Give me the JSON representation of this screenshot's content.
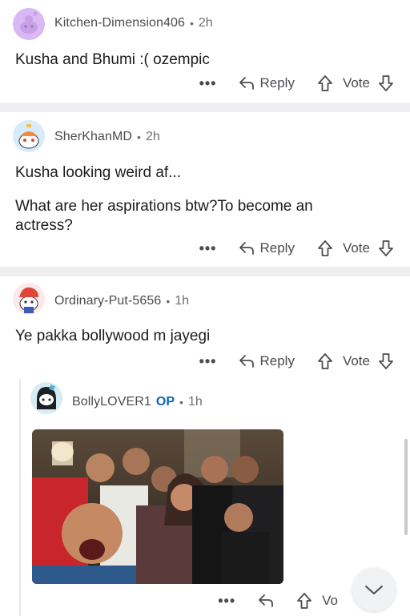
{
  "comments": [
    {
      "username": "Kitchen-Dimension406",
      "time": "2h",
      "body_lines": [
        "Kusha and Bhumi :( ozempic"
      ],
      "reply_label": "Reply",
      "vote_label": "Vote",
      "avatar_icon": "snoo-avatar-purple"
    },
    {
      "username": "SherKhanMD",
      "time": "2h",
      "body_lines": [
        "Kusha looking weird af...",
        "What are her aspirations btw?To become an",
        "actress?"
      ],
      "reply_label": "Reply",
      "vote_label": "Vote",
      "avatar_icon": "snoo-avatar-propeller-hat"
    },
    {
      "username": "Ordinary-Put-5656",
      "time": "1h",
      "body_lines": [
        "Ye pakka bollywood m jayegi"
      ],
      "reply_label": "Reply",
      "vote_label": "Vote",
      "avatar_icon": "snoo-avatar-red-hair"
    },
    {
      "username": "BollyLOVER1",
      "op_badge": "OP",
      "time": "1h",
      "vote_label_partial": "Vo",
      "avatar_icon": "snoo-avatar-black-hood",
      "image_alt": "group-selfie-photo"
    }
  ],
  "separator": "•",
  "more_label": "•••",
  "colors": {
    "background": "#ffffff",
    "divider": "#efeff1",
    "op": "#0f66b8",
    "text": "#1c1c1c",
    "meta": "#4a4c50"
  }
}
